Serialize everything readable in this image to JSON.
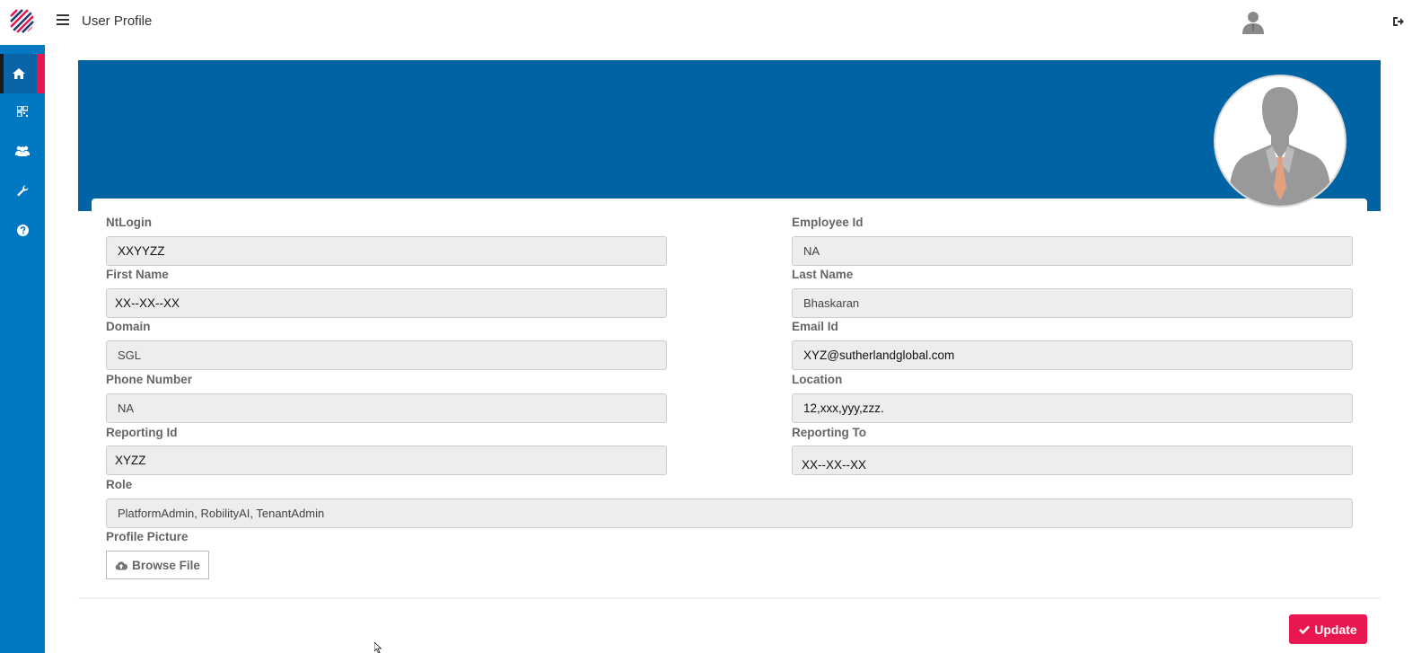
{
  "header": {
    "title": "User Profile",
    "icons": {
      "logo": "brand-logo",
      "menu": "hamburger-menu-icon",
      "user": "user-avatar-icon",
      "logout": "logout-icon"
    }
  },
  "sidebar": {
    "items": [
      {
        "icon": "home-icon",
        "active": true
      },
      {
        "icon": "dashboard-icon",
        "active": false
      },
      {
        "icon": "users-icon",
        "active": false
      },
      {
        "icon": "wrench-icon",
        "active": false
      },
      {
        "icon": "help-icon",
        "active": false
      }
    ]
  },
  "profile": {
    "fields": {
      "ntlogin": {
        "label": "NtLogin",
        "value": "XXYYZZ"
      },
      "employee_id": {
        "label": "Employee Id",
        "value": "NA"
      },
      "first_name": {
        "label": "First Name",
        "value": "XX--XX--XX"
      },
      "last_name": {
        "label": "Last Name",
        "value": "Bhaskaran"
      },
      "domain": {
        "label": "Domain",
        "value": "SGL"
      },
      "email_id": {
        "label": "Email Id",
        "value": "XYZ@sutherlandglobal.com"
      },
      "phone_number": {
        "label": "Phone Number",
        "value": "NA"
      },
      "location": {
        "label": "Location",
        "value": "12,xxx,yyy,zzz."
      },
      "reporting_id": {
        "label": "Reporting Id",
        "value": "XYZZ"
      },
      "reporting_to": {
        "label": "Reporting To",
        "value": "XX--XX--XX"
      },
      "role": {
        "label": "Role",
        "value": "PlatformAdmin, RobilityAI, TenantAdmin"
      }
    },
    "profile_picture_label": "Profile Picture",
    "browse_label": "Browse File",
    "update_label": "Update"
  },
  "colors": {
    "sidebar": "#0078c4",
    "banner": "#0064a4",
    "accent": "#e8174f"
  }
}
